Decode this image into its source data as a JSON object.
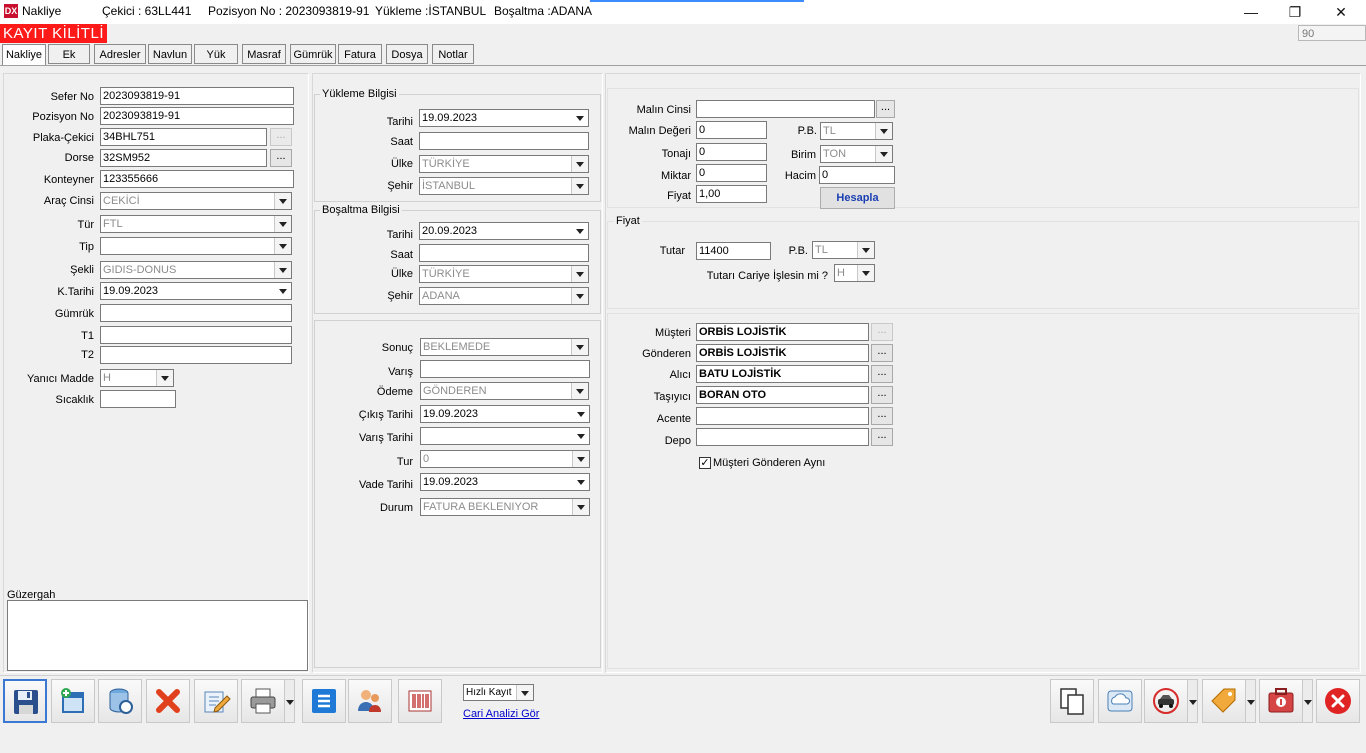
{
  "titlebar": {
    "app_title": "Nakliye",
    "cekici": "Çekici : 63LL441",
    "pozisyon": "Pozisyon No : 2023093819-91",
    "yukleme": "Yükleme :İSTANBUL",
    "bosaltma": "Boşaltma :ADANA",
    "minimize": "—",
    "restore": "❐",
    "close": "✕"
  },
  "locked_label": "KAYIT KİLİTLİ",
  "counter": "90",
  "tabs": [
    "Nakliye",
    "Ek",
    "Adresler",
    "Navlun",
    "Yük",
    "Masraf",
    "Gümrük",
    "Fatura",
    "Dosya",
    "Notlar"
  ],
  "left": {
    "sefer_no_label": "Sefer No",
    "sefer_no": "2023093819-91",
    "pozisyon_no_label": "Pozisyon No",
    "pozisyon_no": "2023093819-91",
    "plaka_label": "Plaka-Çekici",
    "plaka": "34BHL751",
    "dorse_label": "Dorse",
    "dorse": "32SM952",
    "konteyner_label": "Konteyner",
    "konteyner": "123355666",
    "arac_cinsi_label": "Araç Cinsi",
    "arac_cinsi": "CEKİCİ",
    "tur_label": "Tür",
    "tur": "FTL",
    "tip_label": "Tip",
    "tip": "",
    "sekli_label": "Şekli",
    "sekli": "GIDIS-DONUS",
    "ktarihi_label": "K.Tarihi",
    "ktarihi": "19.09.2023",
    "gumruk_label": "Gümrük",
    "gumruk": "",
    "t1_label": "T1",
    "t1": "",
    "t2_label": "T2",
    "t2": "",
    "yanici_label": "Yanıcı Madde",
    "yanici": "H",
    "sicaklik_label": "Sıcaklık",
    "sicaklik": "",
    "guzergah_label": "Güzergah",
    "dots": "..."
  },
  "yukleme": {
    "title": "Yükleme Bilgisi",
    "tarihi_label": "Tarihi",
    "tarihi": "19.09.2023",
    "saat_label": "Saat",
    "saat": "",
    "ulke_label": "Ülke",
    "ulke": "TÜRKİYE",
    "sehir_label": "Şehir",
    "sehir": "İSTANBUL"
  },
  "bosaltma": {
    "title": "Boşaltma Bilgisi",
    "tarihi_label": "Tarihi",
    "tarihi": "20.09.2023",
    "saat_label": "Saat",
    "saat": "",
    "ulke_label": "Ülke",
    "ulke": "TÜRKİYE",
    "sehir_label": "Şehir",
    "sehir": "ADANA"
  },
  "sonuc": {
    "sonuc_label": "Sonuç",
    "sonuc": "BEKLEMEDE",
    "varis_label": "Varış",
    "varis": "",
    "odeme_label": "Ödeme",
    "odeme": "GÖNDEREN",
    "cikis_label": "Çıkış Tarihi",
    "cikis": "19.09.2023",
    "varis_tarihi_label": "Varış Tarihi",
    "varis_tarihi": "",
    "tur_label": "Tur",
    "tur": "0",
    "vade_label": "Vade Tarihi",
    "vade": "19.09.2023",
    "durum_label": "Durum",
    "durum": "FATURA BEKLENIYOR"
  },
  "mal": {
    "cinsi_label": "Malın Cinsi",
    "cinsi": "",
    "degeri_label": "Malın Değeri",
    "degeri": "0",
    "pb_label": "P.B.",
    "pb": "TL",
    "tonaj_label": "Tonajı",
    "tonaj": "0",
    "birim_label": "Birim",
    "birim": "TON",
    "miktar_label": "Miktar",
    "miktar": "0",
    "hacim_label": "Hacim",
    "hacim": "0",
    "fiyat_label": "Fiyat",
    "fiyat": "1,00",
    "hesapla": "Hesapla"
  },
  "fiyat": {
    "title": "Fiyat",
    "tutar_label": "Tutar",
    "tutar": "11400",
    "pb_label": "P.B.",
    "pb": "TL",
    "cari_label": "Tutarı Cariye İşlesin mi ?",
    "cari": "H"
  },
  "taraflar": {
    "musteri_label": "Müşteri",
    "musteri": "ORBİS LOJİSTİK",
    "gonderen_label": "Gönderen",
    "gonderen": "ORBİS LOJİSTİK",
    "alici_label": "Alıcı",
    "alici": "BATU LOJİSTİK",
    "tasiyici_label": "Taşıyıcı",
    "tasiyici": "BORAN OTO",
    "acente_label": "Acente",
    "acente": "",
    "depo_label": "Depo",
    "depo": "",
    "ayni_label": "Müşteri Gönderen Aynı",
    "ayni_check": "✓"
  },
  "bottom": {
    "hizli_kayit": "Hızlı Kayıt",
    "cari_analiz": "Cari Analizi Gör"
  },
  "colors": {
    "locked_bg": "#ff1a1a",
    "link": "#0000cc",
    "hesapla_text": "#1a3fb3"
  }
}
